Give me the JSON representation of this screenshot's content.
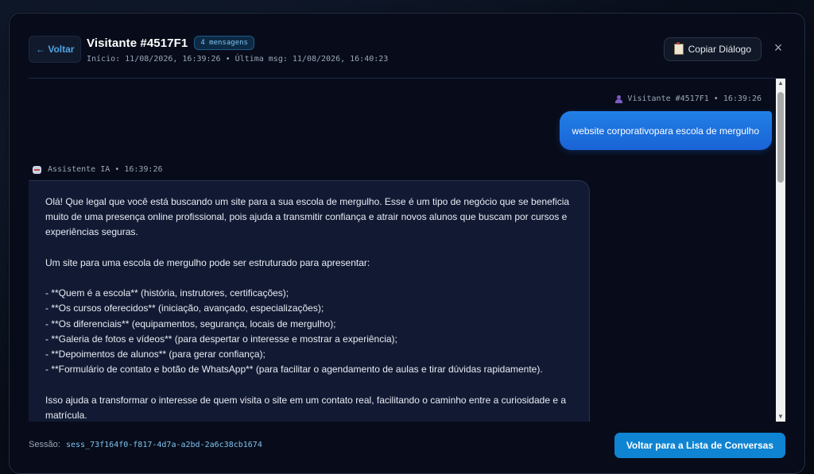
{
  "header": {
    "back_label": "← Voltar",
    "title": "Visitante #4517F1",
    "message_count": "4 mensagens",
    "subtitle": "Início: 11/08/2026, 16:39:26 • Última msg: 11/08/2026, 16:40:23",
    "copy_label": "Copiar Diálogo",
    "copy_icon": "clipboard-icon",
    "close_icon": "×"
  },
  "messages": {
    "user": {
      "meta": "Visitante #4517F1 • 16:39:26",
      "icon": "user-icon",
      "text": "website corporativopara escola de mergulho"
    },
    "assistant": {
      "meta": "Assistente IA • 16:39:26",
      "icon": "robot-icon",
      "intro": "Olá! Que legal que você está buscando um site para a sua escola de mergulho. Esse é um tipo de negócio que se beneficia muito de uma presença online profissional, pois ajuda a transmitir confiança e atrair novos alunos que buscam por cursos e experiências seguras.",
      "lead": "Um site para uma escola de mergulho pode ser estruturado para apresentar:",
      "items": [
        "- **Quem é a escola** (história, instrutores, certificações);",
        "- **Os cursos oferecidos** (iniciação, avançado, especializações);",
        "- **Os diferenciais** (equipamentos, segurança, locais de mergulho);",
        "- **Galeria de fotos e vídeos** (para despertar o interesse e mostrar a experiência);",
        "- **Depoimentos de alunos** (para gerar confiança);",
        "- **Formulário de contato e botão de WhatsApp** (para facilitar o agendamento de aulas e tirar dúvidas rapidamente)."
      ],
      "closing": "Isso ajuda a transformar o interesse de quem visita o site em um contato real, facilitando o caminho entre a curiosidade e a matrícula."
    }
  },
  "footer": {
    "session_label": "Sessão:",
    "session_id": "sess_73f164f0-f817-4d7a-a2bd-2a6c38cb1674",
    "return_label": "Voltar para a Lista de Conversas"
  },
  "scrollbar": {
    "up_glyph": "▲",
    "down_glyph": "▼"
  },
  "colors": {
    "accent": "#0f84d2",
    "user_bubble": "#1a6fe0",
    "assistant_bubble": "#121a33",
    "background": "#080c1a"
  }
}
